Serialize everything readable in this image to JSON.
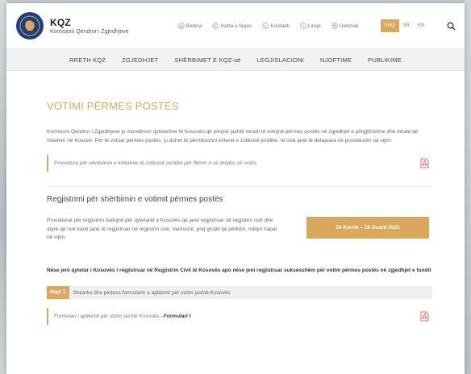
{
  "header": {
    "org_short": "KQZ",
    "org_full": "Komisioni Qendror i Zgjedhjeve",
    "top_links": [
      {
        "label": "Ballina",
        "icon": "home-icon"
      },
      {
        "label": "Harta e faqes",
        "icon": "sitemap-icon"
      },
      {
        "label": "Kontakti",
        "icon": "phone-icon"
      },
      {
        "label": "Linqe",
        "icon": "link-icon"
      },
      {
        "label": "Uebmail",
        "icon": "mail-icon"
      }
    ],
    "languages": [
      "SHQ",
      "SR",
      "EN"
    ],
    "active_language": "SHQ"
  },
  "nav": {
    "items": [
      "RRETH KQZ",
      "ZGJEDHJET",
      "SHËRBIMET E KQZ-së",
      "LEGJISLACIONI",
      "NJOFTIME",
      "PUBLIKIME"
    ]
  },
  "main": {
    "title": "VOTIMI PËRMES POSTËS",
    "intro": "Komisioni Qendror i Zgjedhjeve ju mundëson qytetarëve të Kosovës që jetojnë jashtë vendit të votojnë përmes postës në zgjedhjet e përgjithshme dhe lokale që mbahen në Kosovë. Për të votuar përmes postës, ju duhet të përmbushni kriteret e zotësisë juridike, të cilat janë të detajuara në procedurën na vijim:",
    "procedure_link": "Procedura për vlerësimin e kritereve të zotësisë juridike për fitimin e së drejtës së votës",
    "registration_title": "Regjistrimi për shërbimin e votimit përmes postës",
    "registration_text": "Procedurat për regjistrim dallojnë për qytetarët e Kosovës që janë regjistruar në regjistrin civil dhe atyre që nuk kanë janë të regjistruar në regjistrin civil. Varësisht, prej grupit që përkitni, ndiqni hapat në vijim.",
    "registration_dates": "10 Korrik – 18 Gusht 2021",
    "notice": "Nëse jeni qytetar i Kosovës i regjistruar në Regjistrin Civil të Kosovës apo nëse jeni regjistruar suksesshëm për votim përmes postës në zgjedhjet e fundit",
    "step_badge": "Hapi 1",
    "step_text": "Shkarko dhe ploteso formularin e aplikimit për votim jashtë Kosovës",
    "form_text": "Formulari i aplikimit për votim jashtë Kosovës – ",
    "form_link": "Formulari I"
  },
  "colors": {
    "accent": "#d9a85a",
    "logo_blue": "#1d3f7a"
  }
}
